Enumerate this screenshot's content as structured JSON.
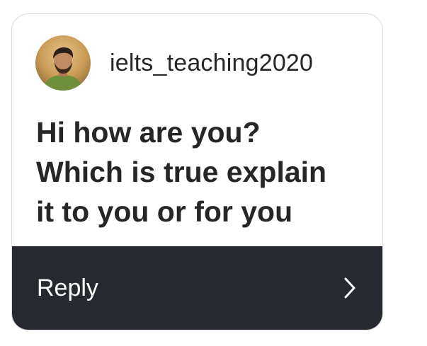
{
  "notification": {
    "username": "ielts_teaching2020",
    "message_lines": [
      "Hi how are you?",
      "Which is true explain",
      "it to you or for you"
    ],
    "reply_label": "Reply"
  },
  "icons": {
    "avatar": "profile-photo",
    "reply_arrow": "chevron-right-icon"
  },
  "colors": {
    "reply_bar": "#262a30",
    "text": "#262626",
    "card_border": "#dcdcdc"
  }
}
